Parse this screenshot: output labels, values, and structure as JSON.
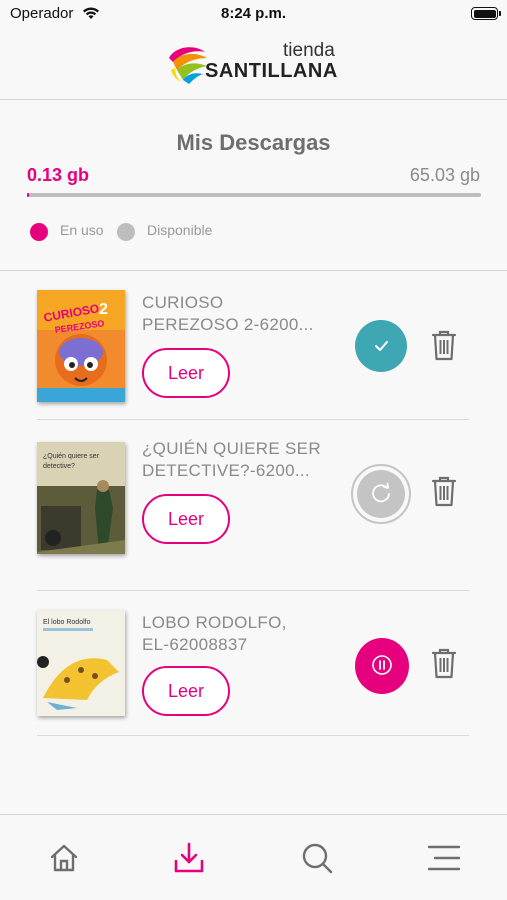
{
  "status_bar": {
    "carrier": "Operador",
    "time": "8:24 p.m."
  },
  "logo": {
    "small": "tienda",
    "name": "SANTILLANA"
  },
  "downloads": {
    "title": "Mis Descargas",
    "used": "0.13 gb",
    "total": "65.03 gb",
    "used_fraction": 0.002,
    "legend_used": "En uso",
    "legend_available": "Disponible"
  },
  "books": [
    {
      "title_line1": "CURIOSO",
      "title_line2": "PEREZOSO 2-6200...",
      "read_label": "Leer",
      "status": "downloaded",
      "cover_title": "CURIOSO PEREZOSO 2"
    },
    {
      "title_line1": "¿QUIÉN QUIERE SER",
      "title_line2": "DETECTIVE?-6200...",
      "read_label": "Leer",
      "status": "pending",
      "cover_title": "¿Quién quiere ser detective?"
    },
    {
      "title_line1": "LOBO RODOLFO,",
      "title_line2": "EL-62008837",
      "read_label": "Leer",
      "status": "paused",
      "cover_title": "El lobo Rodolfo"
    }
  ],
  "colors": {
    "accent": "#e6007e",
    "done": "#3fa6b3",
    "pending": "#c4c4c4",
    "text": "#8a8a8a"
  },
  "tabs": [
    {
      "name": "home-icon"
    },
    {
      "name": "download-icon",
      "active": true
    },
    {
      "name": "search-icon"
    },
    {
      "name": "menu-icon"
    }
  ]
}
